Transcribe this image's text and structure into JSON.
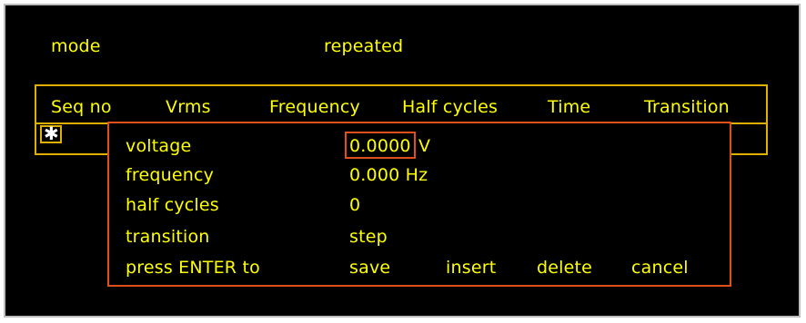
{
  "top": {
    "mode_label": "mode",
    "mode_value": "repeated"
  },
  "table": {
    "headers": [
      "Seq no",
      "Vrms",
      "Frequency",
      "Half cycles",
      "Time",
      "Transition"
    ]
  },
  "dialog": {
    "voltage_label": "voltage",
    "voltage_value": "0.0000",
    "voltage_unit": "V",
    "frequency_label": "frequency",
    "frequency_value": "0.000 Hz",
    "half_cycles_label": "half cycles",
    "half_cycles_value": "0",
    "transition_label": "transition",
    "transition_value": "step",
    "prompt_label": "press ENTER to",
    "actions": [
      "save",
      "insert",
      "delete",
      "cancel"
    ]
  },
  "colors": {
    "text": "#ffff00",
    "table_border": "#e0b000",
    "dialog_border": "#e0501a",
    "background": "#000000"
  }
}
